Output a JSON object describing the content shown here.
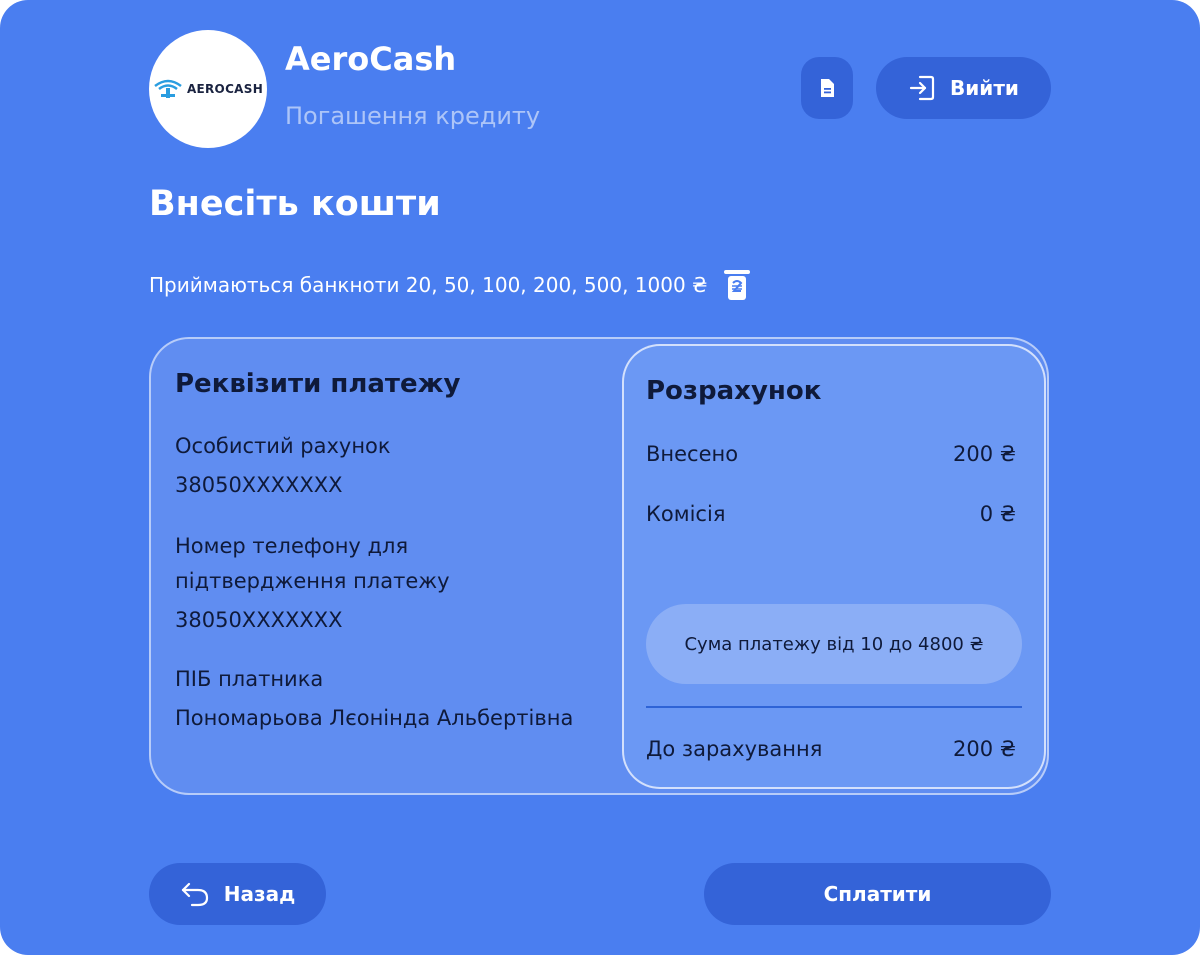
{
  "brand": {
    "logo_text": "AEROCASH",
    "name": "AeroCash",
    "subtitle": "Погашення кредиту"
  },
  "header": {
    "exit_label": "Вийти",
    "doc_icon": "document-icon",
    "exit_icon": "sign-in-icon"
  },
  "page": {
    "title": "Внесіть кошти",
    "banknotes": "Приймаються банкноти 20, 50, 100, 200, 500, 1000 ₴",
    "banknote_icon": "cash-slot-icon"
  },
  "details": {
    "title": "Реквізити платежу",
    "account_label": "Особистий рахунок",
    "account_value": "38050XXXXXXX",
    "phone_label_line1": "Номер телефону для",
    "phone_label_line2": "підтвердження платежу",
    "phone_value": "38050XXXXXXX",
    "payer_label": "ПІБ платника",
    "payer_value": "Пономарьова Лєонінда Альбертівна"
  },
  "calculation": {
    "title": "Розрахунок",
    "deposited_label": "Внесено",
    "deposited_value": "200 ₴",
    "fee_label": "Комісія",
    "fee_value": "0 ₴",
    "limit_text": "Сума платежу від 10 до 4800 ₴",
    "total_label": "До зарахування",
    "total_value": "200 ₴"
  },
  "footer": {
    "back_label": "Назад",
    "back_icon": "undo-arrow-icon",
    "pay_label": "Сплатити"
  },
  "colors": {
    "background": "#4a7ef0",
    "button": "#3463d8",
    "panel": "#6b98f4",
    "text_dark": "#0f1a3a"
  }
}
